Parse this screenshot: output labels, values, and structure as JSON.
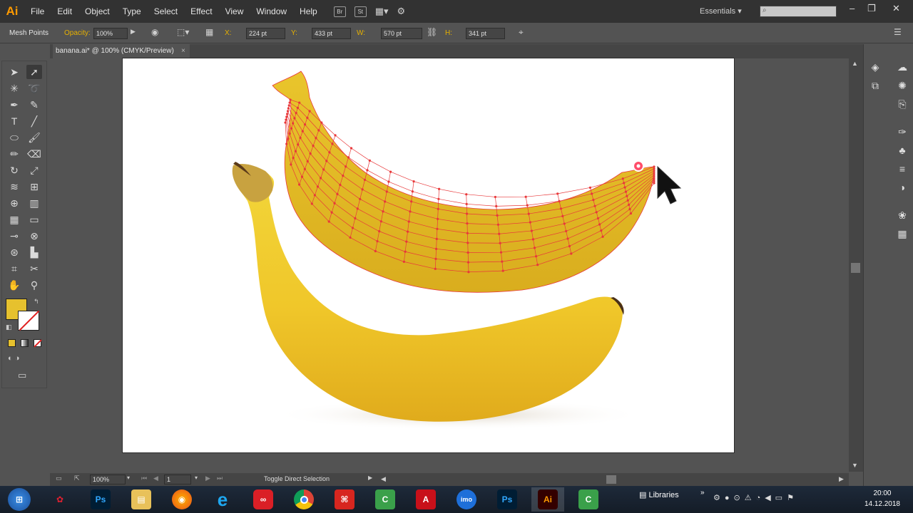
{
  "app": {
    "logo": "Ai",
    "accent": "#ff9a00"
  },
  "menu": [
    "File",
    "Edit",
    "Object",
    "Type",
    "Select",
    "Effect",
    "View",
    "Window",
    "Help"
  ],
  "bridge_buttons": [
    "Br",
    "St"
  ],
  "workspace": "Essentials",
  "control_bar": {
    "tool_name": "Mesh Points",
    "opacity_label": "Opacity:",
    "opacity_value": "100%",
    "x_label": "X:",
    "x_value": "224 pt",
    "y_label": "Y:",
    "y_value": "433 pt",
    "w_label": "W:",
    "w_value": "570 pt",
    "h_label": "H:",
    "h_value": "341 pt"
  },
  "document_tab": {
    "title": "banana.ai* @ 100% (CMYK/Preview)",
    "close": "×"
  },
  "status_bar": {
    "zoom": "100%",
    "artboard": "1",
    "message": "Toggle Direct Selection"
  },
  "colors": {
    "fill": "#e6c12e",
    "stroke": "#ffffff",
    "mesh": "#e8383a",
    "banana": "#f0cd2a"
  },
  "taskbar": {
    "apps": [
      "Photoshop",
      "File Explorer",
      "Firefox",
      "Internet Explorer",
      "Creative Cloud",
      "Chrome",
      "Acrobat",
      "Camtasia",
      "Adobe Reader",
      "imo",
      "Photoshop",
      "Illustrator",
      "Camtasia"
    ],
    "libraries": "Libraries",
    "time": "20:00",
    "date": "14.12.2018"
  }
}
